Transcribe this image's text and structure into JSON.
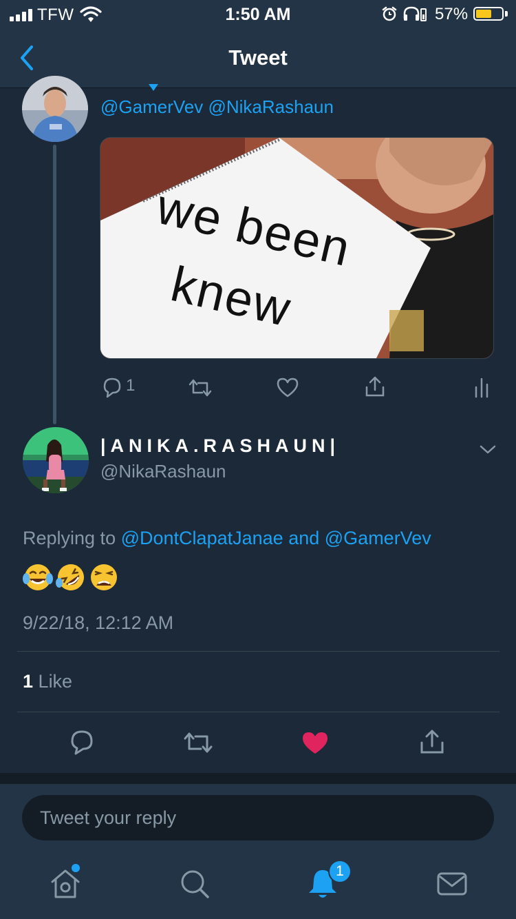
{
  "status_bar": {
    "carrier": "TFW",
    "time": "1:50 AM",
    "battery_percent": "57%",
    "battery_level": 0.57,
    "icons": [
      "signal-bars-icon",
      "wifi-icon",
      "alarm-icon",
      "headphones-icon",
      "battery-icon"
    ]
  },
  "nav": {
    "title": "Tweet",
    "back_icon": "chevron-left-icon"
  },
  "previous_tweet": {
    "mentions": [
      "@GamerVev",
      "@NikaRashaun"
    ],
    "media_text": [
      "we been",
      "knew"
    ],
    "reply_count": "1",
    "actions": [
      "reply-icon",
      "retweet-icon",
      "like-icon",
      "share-icon",
      "analytics-icon"
    ]
  },
  "tweet": {
    "display_name": "|ANIKA.RASHAUN|",
    "handle": "@NikaRashaun",
    "replying_prefix": "Replying to",
    "replying_to_1": "@DontClapatJanae",
    "replying_and": "and",
    "replying_to_2": "@GamerVev",
    "body_emojis": [
      "😂",
      "🤣",
      "😩"
    ],
    "timestamp": "9/22/18, 12:12 AM",
    "like_count": "1",
    "like_label": "Like",
    "liked": true,
    "colors": {
      "accent": "#1da1f2",
      "like": "#e0245e",
      "background": "#1c2939",
      "muted": "#8899a6"
    }
  },
  "composer": {
    "placeholder": "Tweet your reply"
  },
  "tab_bar": {
    "tabs": [
      "home-icon",
      "search-icon",
      "notifications-icon",
      "messages-icon"
    ],
    "notification_badge": "1"
  }
}
